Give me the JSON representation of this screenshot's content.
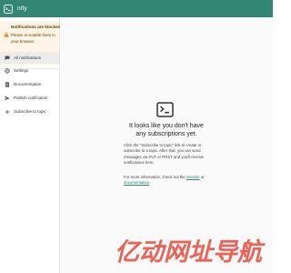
{
  "app": {
    "title": "ntfy",
    "icon": "ntfy-logo-icon"
  },
  "alert": {
    "icon": "warning-icon",
    "title": "Notifications are blocked",
    "body": "Please re-enable them in your browser"
  },
  "sidebar": {
    "items": [
      {
        "label": "All notifications",
        "icon": "chat-bubble-icon",
        "active": true
      },
      {
        "label": "Settings",
        "icon": "gear-icon",
        "active": false
      },
      {
        "label": "Documentation",
        "icon": "document-icon",
        "active": false
      },
      {
        "label": "Publish notification",
        "icon": "send-icon",
        "active": false
      },
      {
        "label": "Subscribe to topic",
        "icon": "plus-icon",
        "active": false
      }
    ]
  },
  "empty_state": {
    "icon": "terminal-icon",
    "title": "It looks like you don't have any subscriptions yet.",
    "paragraph1": "Click the \"Subscribe to topic\" link to create or subscribe to a topic. After that, you can send messages via PUT or POST and you'll receive notifications here.",
    "paragraph2_prefix": "For more information, check out the",
    "website_link": "website",
    "paragraph2_middle": "or",
    "documentation_link": "documentation",
    "paragraph2_suffix": "."
  },
  "watermark": {
    "text": "亿动网址导航"
  },
  "colors": {
    "topbar": "#338574",
    "alert_bg": "#fff4e5",
    "alert_text": "#663c00",
    "watermark": "#e8473a"
  }
}
